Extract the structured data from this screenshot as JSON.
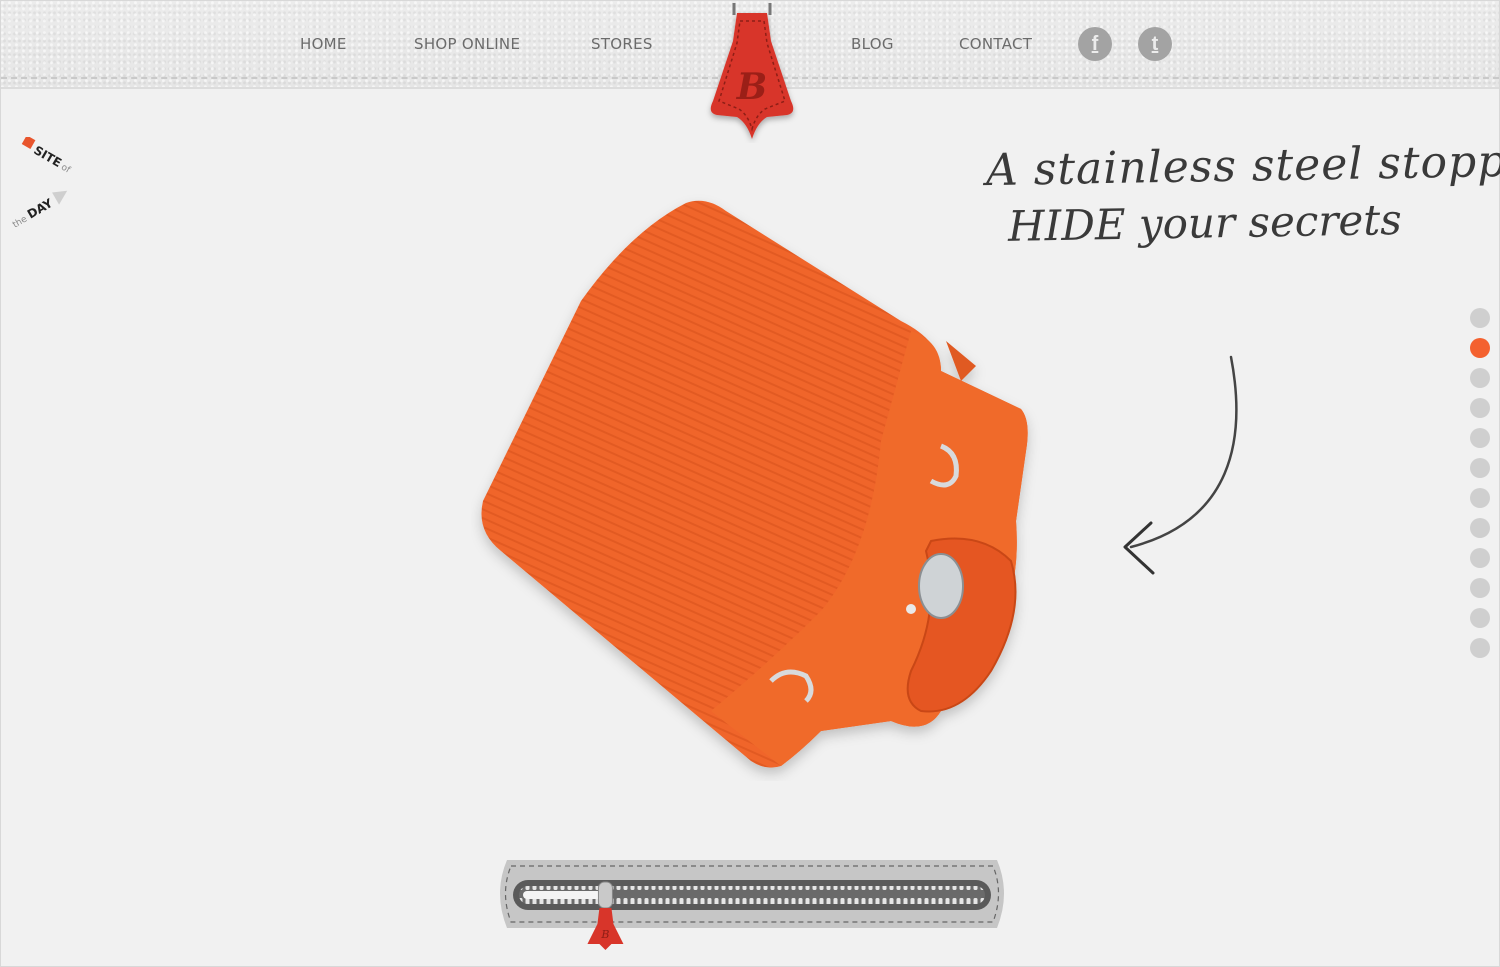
{
  "header": {
    "nav": [
      {
        "label": "HOME"
      },
      {
        "label": "SHOP ONLINE"
      },
      {
        "label": "STORES"
      },
      {
        "label": "BLOG"
      },
      {
        "label": "CONTACT"
      }
    ],
    "logo_letter": "B",
    "social": [
      {
        "name": "facebook",
        "glyph": "f"
      },
      {
        "name": "twitter",
        "glyph": "t"
      }
    ]
  },
  "badge": {
    "line1": "SITE",
    "of": "of",
    "the": "the",
    "line2": "DAY"
  },
  "caption": {
    "line1": "A stainless steel stopper",
    "line2": "HIDE your secrets"
  },
  "slides": {
    "count": 12,
    "active_index": 1
  },
  "colors": {
    "accent": "#f4612f",
    "tag_red": "#d8352a",
    "dot_inactive": "#cfcfcf",
    "nav_text": "#6b6b6b"
  },
  "zipper": {
    "progress": 0.18,
    "pull_letter": "B"
  }
}
